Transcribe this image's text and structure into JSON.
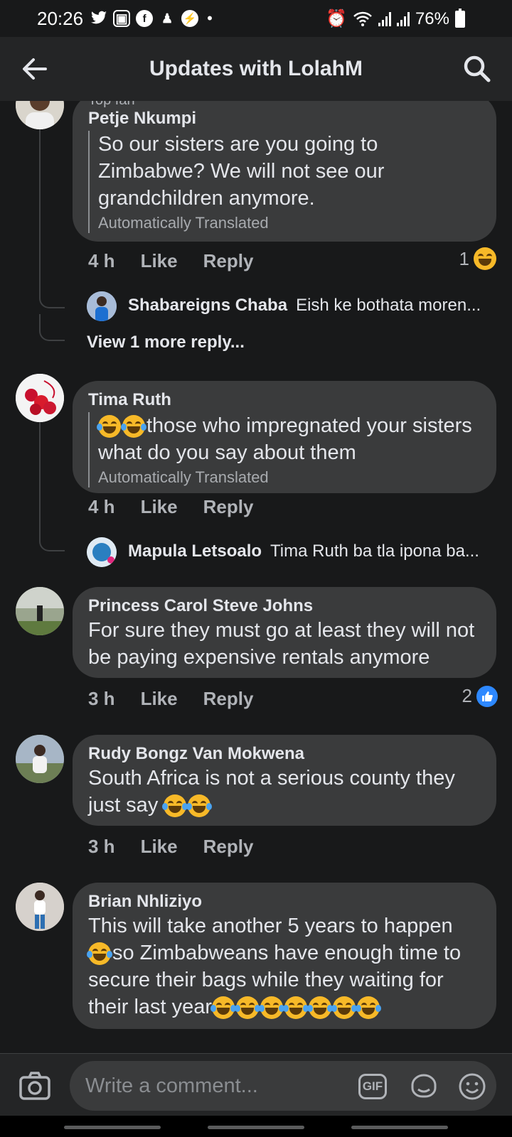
{
  "status_bar": {
    "time": "20:26",
    "battery": "76%"
  },
  "header": {
    "title": "Updates with LolahM"
  },
  "comments": [
    {
      "top_fan": "Top fan",
      "author": "Petje Nkumpi",
      "text": "So our sisters are you going to Zimbabwe? We will not see our grandchildren anymore.",
      "translated": "Automatically Translated",
      "time": "4 h",
      "like": "Like",
      "reply": "Reply",
      "reaction_count": "1",
      "replies": [
        {
          "author": "Shabareigns Chaba",
          "text": "Eish ke bothata moren..."
        }
      ],
      "view_more": "View 1 more reply..."
    },
    {
      "author": "Tima Ruth",
      "text": "those who impregnated your sisters what do you say about them",
      "translated": "Automatically Translated",
      "time": "4 h",
      "like": "Like",
      "reply": "Reply",
      "replies": [
        {
          "author": "Mapula Letsoalo",
          "text": "Tima Ruth ba tla ipona ba..."
        }
      ]
    },
    {
      "author": "Princess Carol Steve Johns",
      "text": "For sure they must go at least they will not be paying expensive rentals anymore",
      "time": "3 h",
      "like": "Like",
      "reply": "Reply",
      "reaction_count": "2"
    },
    {
      "author": "Rudy Bongz Van Mokwena",
      "text": "South Africa is not a serious county they just say",
      "time": "3 h",
      "like": "Like",
      "reply": "Reply"
    },
    {
      "author": "Brian Nhliziyo",
      "text_1": "This will take another 5 years to happen",
      "text_2": "so Zimbabweans have enough time to secure their bags while they waiting for their last year"
    }
  ],
  "composer": {
    "placeholder": "Write a comment...",
    "gif": "GIF"
  },
  "colors": {
    "background": "#18191a",
    "bubble": "#3a3b3c",
    "bar": "#242526",
    "like_blue": "#2d88ff"
  }
}
